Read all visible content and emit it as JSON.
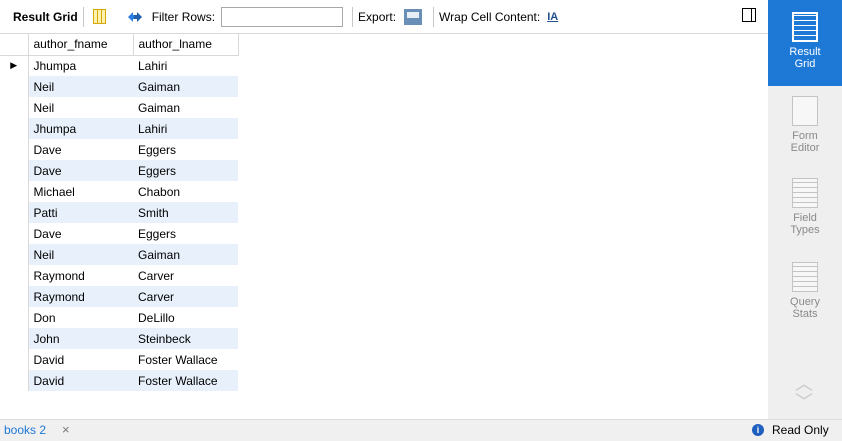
{
  "toolbar": {
    "result_grid_label": "Result Grid",
    "filter_rows_label": "Filter Rows:",
    "filter_value": "",
    "export_label": "Export:",
    "wrap_label": "Wrap Cell Content:",
    "wrap_icon_text": "IA"
  },
  "grid": {
    "columns": [
      "author_fname",
      "author_lname"
    ],
    "rows": [
      [
        "Jhumpa",
        "Lahiri"
      ],
      [
        "Neil",
        "Gaiman"
      ],
      [
        "Neil",
        "Gaiman"
      ],
      [
        "Jhumpa",
        "Lahiri"
      ],
      [
        "Dave",
        "Eggers"
      ],
      [
        "Dave",
        "Eggers"
      ],
      [
        "Michael",
        "Chabon"
      ],
      [
        "Patti",
        "Smith"
      ],
      [
        "Dave",
        "Eggers"
      ],
      [
        "Neil",
        "Gaiman"
      ],
      [
        "Raymond",
        "Carver"
      ],
      [
        "Raymond",
        "Carver"
      ],
      [
        "Don",
        "DeLillo"
      ],
      [
        "John",
        "Steinbeck"
      ],
      [
        "David",
        "Foster Wallace"
      ],
      [
        "David",
        "Foster Wallace"
      ]
    ],
    "current_row_marker": "▶"
  },
  "sidebar": {
    "items": [
      {
        "label_line1": "Result",
        "label_line2": "Grid"
      },
      {
        "label_line1": "Form",
        "label_line2": "Editor"
      },
      {
        "label_line1": "Field",
        "label_line2": "Types"
      },
      {
        "label_line1": "Query",
        "label_line2": "Stats"
      }
    ],
    "active_color": "#1e78d6"
  },
  "bottom": {
    "tab_label": "books 2",
    "tab_close": "×",
    "info_glyph": "i",
    "status": "Read Only"
  }
}
